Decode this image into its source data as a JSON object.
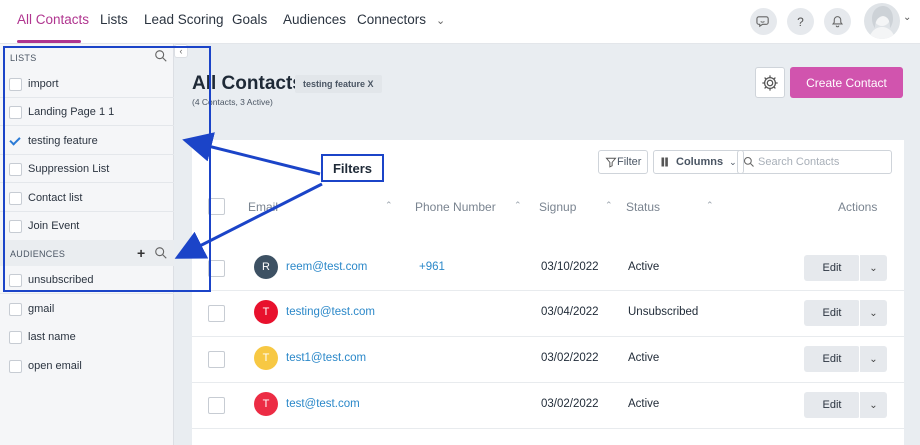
{
  "nav": {
    "tabs": [
      {
        "label": "All Contacts",
        "active": true
      },
      {
        "label": "Lists"
      },
      {
        "label": "Lead Scoring"
      },
      {
        "label": "Goals"
      },
      {
        "label": "Audiences"
      },
      {
        "label": "Connectors"
      }
    ],
    "icons": [
      "chat-icon",
      "help-icon",
      "bell-icon",
      "avatar"
    ]
  },
  "sidebar": {
    "lists_header": "LISTS",
    "lists": [
      {
        "label": "import",
        "checked": false
      },
      {
        "label": "Landing Page 1 1",
        "checked": false
      },
      {
        "label": "testing feature",
        "checked": true
      },
      {
        "label": "Suppression List",
        "checked": false
      },
      {
        "label": "Contact list",
        "checked": false
      },
      {
        "label": "Join Event",
        "checked": false
      }
    ],
    "audiences_header": "AUDIENCES",
    "audiences": [
      {
        "label": "unsubscribed"
      },
      {
        "label": "gmail"
      },
      {
        "label": "last name"
      },
      {
        "label": "open email"
      }
    ]
  },
  "main": {
    "title": "All Contacts",
    "active_list_badge": "testing feature X",
    "counts": "(4 Contacts, 3 Active)",
    "create_button": "Create Contact",
    "toolbar": {
      "filter_label": "Filter",
      "columns_label": "Columns",
      "search_placeholder": "Search Contacts"
    },
    "columns": [
      "Email",
      "Phone Number",
      "Signup",
      "Status",
      "Actions"
    ],
    "rows": [
      {
        "initial": "R",
        "email": "reem@test.com",
        "phone": "+961",
        "signup": "03/10/2022",
        "status": "Active",
        "edit": "Edit",
        "avatar_color": "#3d5163"
      },
      {
        "initial": "T",
        "email": "testing@test.com",
        "phone": "",
        "signup": "03/04/2022",
        "status": "Unsubscribed",
        "edit": "Edit",
        "avatar_color": "#e8112d"
      },
      {
        "initial": "T",
        "email": "test1@test.com",
        "phone": "",
        "signup": "03/02/2022",
        "status": "Active",
        "edit": "Edit",
        "avatar_color": "#f7c843"
      },
      {
        "initial": "T",
        "email": "test@test.com",
        "phone": "",
        "signup": "03/02/2022",
        "status": "Active",
        "edit": "Edit",
        "avatar_color": "#ec2c44"
      }
    ]
  },
  "annotation": {
    "label": "Filters",
    "color": "#1b44c8"
  },
  "colors": {
    "accent": "#b0358f",
    "primary_button": "#d154ae",
    "link": "#2b88c9"
  }
}
